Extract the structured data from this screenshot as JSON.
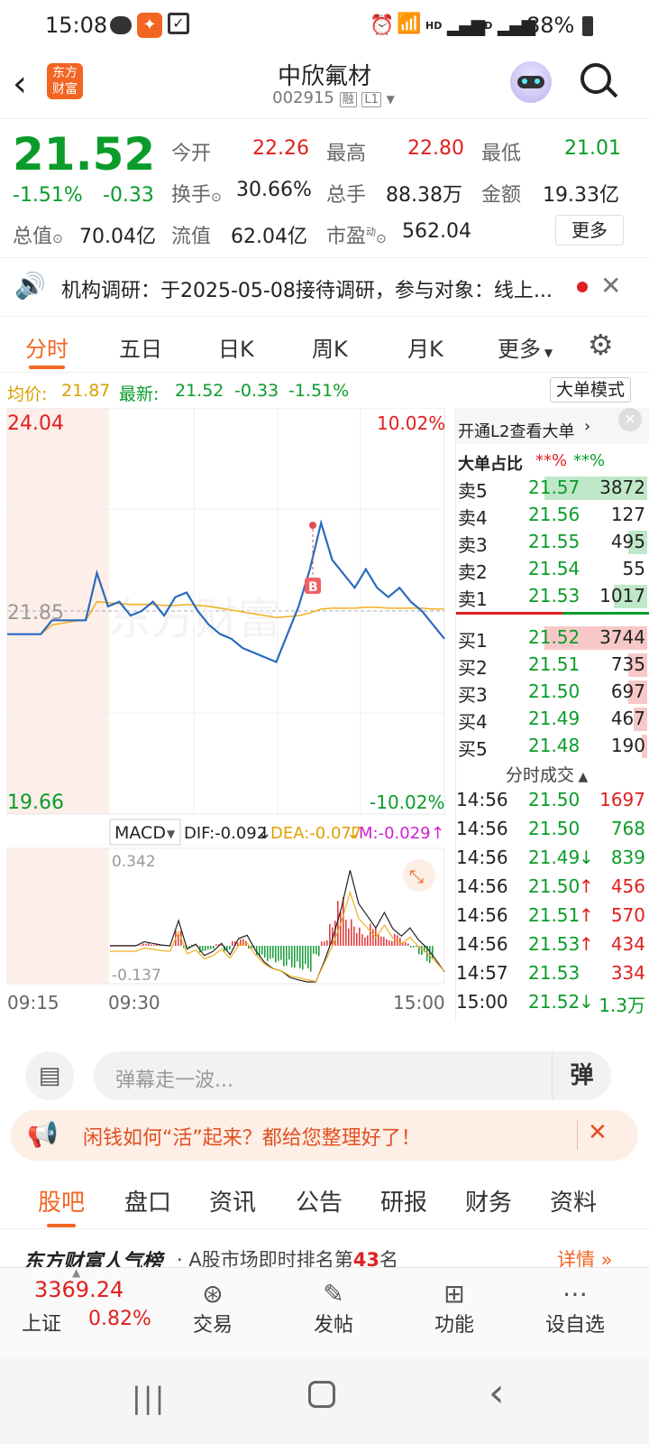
{
  "status_bar": {
    "time": "15:08",
    "battery": "88%",
    "hd1": "HD",
    "hd2": "HD"
  },
  "header": {
    "logo_line1": "东方",
    "logo_line2": "财富",
    "title": "中欣氟材",
    "code": "002915",
    "tag_rong": "融",
    "tag_l1": "L1"
  },
  "quote": {
    "price": "21.52",
    "change_pct": "-1.51%",
    "change": "-0.33",
    "open_label": "今开",
    "open": "22.26",
    "high_label": "最高",
    "high": "22.80",
    "low_label": "最低",
    "low": "21.01",
    "turnover_label": "换手",
    "turnover": "30.66%",
    "volume_label": "总手",
    "volume": "88.38万",
    "amount_label": "金额",
    "amount": "19.33亿",
    "mktcap_label": "总值",
    "mktcap": "70.04亿",
    "float_label": "流值",
    "float": "62.04亿",
    "pe_label": "市盈",
    "pe_sup": "动",
    "pe": "562.04",
    "more_button": "更多"
  },
  "notice": {
    "text": "机构调研：于2025-05-08接待调研，参与对象：线上..."
  },
  "tabs": [
    {
      "label": "分时"
    },
    {
      "label": "五日"
    },
    {
      "label": "日K"
    },
    {
      "label": "周K"
    },
    {
      "label": "月K"
    },
    {
      "label": "更多"
    }
  ],
  "avg_line": {
    "avg_label": "均价:",
    "avg": "21.87",
    "latest_label": "最新:",
    "latest": "21.52",
    "chg": "-0.33",
    "pct": "-1.51%",
    "mode_button": "大单模式"
  },
  "chart": {
    "y_top": "24.04",
    "y_mid": "21.85",
    "y_bot": "19.66",
    "pct_top": "10.02%",
    "pct_bot": "-10.02%",
    "watermark": "东方财富",
    "marker": "B",
    "macd_label": "MACD",
    "dif": "DIF:-0.092",
    "dea": "DEA:-0.077",
    "m": "M:-0.029",
    "macd_top": "0.342",
    "macd_bot": "-0.137",
    "time_start": "09:15",
    "time_open": "09:30",
    "time_end": "15:00"
  },
  "chart_data": {
    "type": "line",
    "xlabel": "",
    "ylabel": "",
    "ylim": [
      19.66,
      24.04
    ],
    "series": [
      {
        "values": [
          21.6,
          21.6,
          21.6,
          21.6,
          21.75,
          21.75,
          21.75,
          21.75,
          22.26,
          21.9,
          21.95,
          21.8,
          21.85,
          21.95,
          21.8,
          22.0,
          22.05,
          21.85,
          21.7,
          21.6,
          21.55,
          21.45,
          21.4,
          21.35,
          21.3,
          21.6,
          21.9,
          22.3,
          22.8,
          22.4,
          22.25,
          22.1,
          22.3,
          22.1,
          22.0,
          22.1,
          21.95,
          21.85,
          21.7,
          21.55
        ]
      },
      {
        "values": [
          21.6,
          21.6,
          21.6,
          21.6,
          21.7,
          21.72,
          21.74,
          21.75,
          21.95,
          21.94,
          21.93,
          21.92,
          21.92,
          21.92,
          21.91,
          21.91,
          21.92,
          21.91,
          21.9,
          21.88,
          21.86,
          21.84,
          21.82,
          21.8,
          21.78,
          21.79,
          21.8,
          21.83,
          21.87,
          21.88,
          21.88,
          21.88,
          21.89,
          21.89,
          21.88,
          21.88,
          21.88,
          21.88,
          21.87,
          21.87
        ]
      }
    ]
  },
  "side": {
    "header": "开通L2查看大单",
    "ratio_label": "大单占比",
    "ratio1": "**%",
    "ratio2": "**%",
    "asks": [
      {
        "label": "卖5",
        "price": "21.57",
        "vol": "3872",
        "bar": 0.55
      },
      {
        "label": "卖4",
        "price": "21.56",
        "vol": "127",
        "bar": 0.0
      },
      {
        "label": "卖3",
        "price": "21.55",
        "vol": "495",
        "bar": 0.1
      },
      {
        "label": "卖2",
        "price": "21.54",
        "vol": "55",
        "bar": 0.0
      },
      {
        "label": "卖1",
        "price": "21.53",
        "vol": "1017",
        "bar": 0.18
      }
    ],
    "bids": [
      {
        "label": "买1",
        "price": "21.52",
        "vol": "3744",
        "bar": 0.55
      },
      {
        "label": "买2",
        "price": "21.51",
        "vol": "735",
        "bar": 0.1
      },
      {
        "label": "买3",
        "price": "21.50",
        "vol": "697",
        "bar": 0.1
      },
      {
        "label": "买4",
        "price": "21.49",
        "vol": "467",
        "bar": 0.07
      },
      {
        "label": "买5",
        "price": "21.48",
        "vol": "190",
        "bar": 0.03
      }
    ],
    "trades_title": "分时成交",
    "trades": [
      {
        "time": "14:56",
        "price": "21.50",
        "arrow": "",
        "vol": "1697",
        "color": "#e02020"
      },
      {
        "time": "14:56",
        "price": "21.50",
        "arrow": "",
        "vol": "768",
        "color": "#0a9c2a"
      },
      {
        "time": "14:56",
        "price": "21.49",
        "arrow": "↓",
        "vol": "839",
        "color": "#0a9c2a"
      },
      {
        "time": "14:56",
        "price": "21.50",
        "arrow": "↑",
        "vol": "456",
        "color": "#e02020"
      },
      {
        "time": "14:56",
        "price": "21.51",
        "arrow": "↑",
        "vol": "570",
        "color": "#e02020"
      },
      {
        "time": "14:56",
        "price": "21.53",
        "arrow": "↑",
        "vol": "434",
        "color": "#e02020"
      },
      {
        "time": "14:57",
        "price": "21.53",
        "arrow": "",
        "vol": "334",
        "color": "#e02020"
      },
      {
        "time": "15:00",
        "price": "21.52",
        "arrow": "↓",
        "vol": "1.3万",
        "color": "#0a9c2a"
      }
    ]
  },
  "comment": {
    "placeholder": "弹幕走一波...",
    "danmu_button": "弹"
  },
  "banner": {
    "text": "闲钱如何“活”起来？都给您整理好了！"
  },
  "subtabs": [
    {
      "label": "股吧"
    },
    {
      "label": "盘口"
    },
    {
      "label": "资讯"
    },
    {
      "label": "公告"
    },
    {
      "label": "研报"
    },
    {
      "label": "财务"
    },
    {
      "label": "资料"
    }
  ],
  "ranking": {
    "brand": "东方财富人气榜",
    "text": "· A股市场即时排名第",
    "rank": "43",
    "unit": "名",
    "detail": "详情"
  },
  "bottom_nav": {
    "index_value": "3369.24",
    "index_name": "上证",
    "index_pct": "0.82%",
    "items": [
      {
        "label": "交易"
      },
      {
        "label": "发帖"
      },
      {
        "label": "功能"
      },
      {
        "label": "设自选"
      }
    ]
  },
  "colors": {
    "accent": "#f26522",
    "up": "#e02020",
    "down": "#0a9c2a",
    "line": "#2a6bc0",
    "avg": "#f0b020"
  }
}
